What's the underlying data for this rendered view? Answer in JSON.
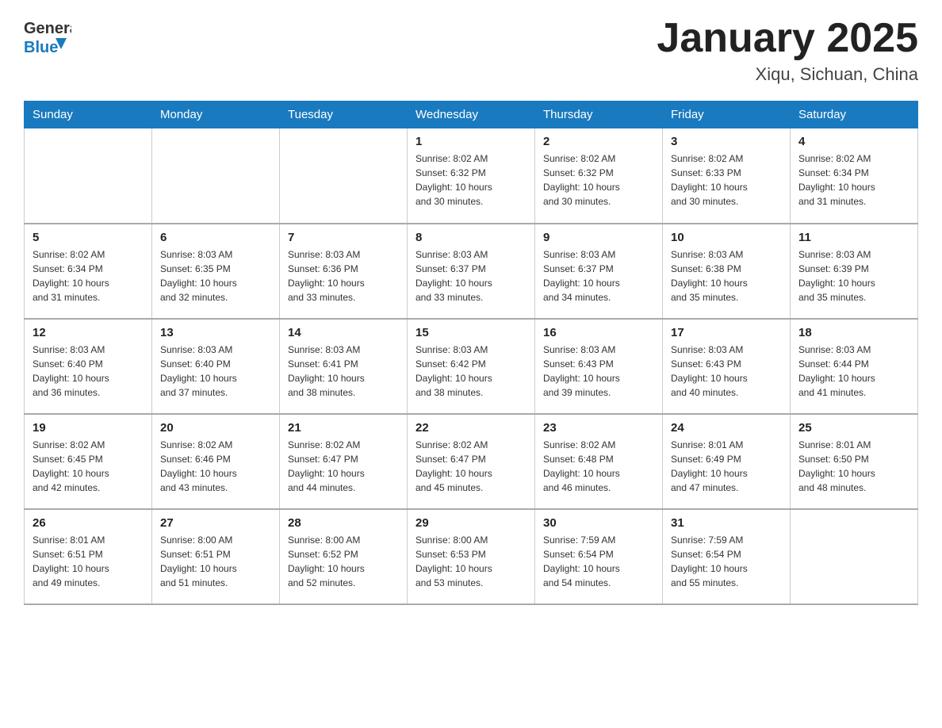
{
  "header": {
    "logo_general": "General",
    "logo_blue": "Blue",
    "month_title": "January 2025",
    "location": "Xiqu, Sichuan, China"
  },
  "days_of_week": [
    "Sunday",
    "Monday",
    "Tuesday",
    "Wednesday",
    "Thursday",
    "Friday",
    "Saturday"
  ],
  "weeks": [
    [
      {
        "day": "",
        "info": ""
      },
      {
        "day": "",
        "info": ""
      },
      {
        "day": "",
        "info": ""
      },
      {
        "day": "1",
        "info": "Sunrise: 8:02 AM\nSunset: 6:32 PM\nDaylight: 10 hours\nand 30 minutes."
      },
      {
        "day": "2",
        "info": "Sunrise: 8:02 AM\nSunset: 6:32 PM\nDaylight: 10 hours\nand 30 minutes."
      },
      {
        "day": "3",
        "info": "Sunrise: 8:02 AM\nSunset: 6:33 PM\nDaylight: 10 hours\nand 30 minutes."
      },
      {
        "day": "4",
        "info": "Sunrise: 8:02 AM\nSunset: 6:34 PM\nDaylight: 10 hours\nand 31 minutes."
      }
    ],
    [
      {
        "day": "5",
        "info": "Sunrise: 8:02 AM\nSunset: 6:34 PM\nDaylight: 10 hours\nand 31 minutes."
      },
      {
        "day": "6",
        "info": "Sunrise: 8:03 AM\nSunset: 6:35 PM\nDaylight: 10 hours\nand 32 minutes."
      },
      {
        "day": "7",
        "info": "Sunrise: 8:03 AM\nSunset: 6:36 PM\nDaylight: 10 hours\nand 33 minutes."
      },
      {
        "day": "8",
        "info": "Sunrise: 8:03 AM\nSunset: 6:37 PM\nDaylight: 10 hours\nand 33 minutes."
      },
      {
        "day": "9",
        "info": "Sunrise: 8:03 AM\nSunset: 6:37 PM\nDaylight: 10 hours\nand 34 minutes."
      },
      {
        "day": "10",
        "info": "Sunrise: 8:03 AM\nSunset: 6:38 PM\nDaylight: 10 hours\nand 35 minutes."
      },
      {
        "day": "11",
        "info": "Sunrise: 8:03 AM\nSunset: 6:39 PM\nDaylight: 10 hours\nand 35 minutes."
      }
    ],
    [
      {
        "day": "12",
        "info": "Sunrise: 8:03 AM\nSunset: 6:40 PM\nDaylight: 10 hours\nand 36 minutes."
      },
      {
        "day": "13",
        "info": "Sunrise: 8:03 AM\nSunset: 6:40 PM\nDaylight: 10 hours\nand 37 minutes."
      },
      {
        "day": "14",
        "info": "Sunrise: 8:03 AM\nSunset: 6:41 PM\nDaylight: 10 hours\nand 38 minutes."
      },
      {
        "day": "15",
        "info": "Sunrise: 8:03 AM\nSunset: 6:42 PM\nDaylight: 10 hours\nand 38 minutes."
      },
      {
        "day": "16",
        "info": "Sunrise: 8:03 AM\nSunset: 6:43 PM\nDaylight: 10 hours\nand 39 minutes."
      },
      {
        "day": "17",
        "info": "Sunrise: 8:03 AM\nSunset: 6:43 PM\nDaylight: 10 hours\nand 40 minutes."
      },
      {
        "day": "18",
        "info": "Sunrise: 8:03 AM\nSunset: 6:44 PM\nDaylight: 10 hours\nand 41 minutes."
      }
    ],
    [
      {
        "day": "19",
        "info": "Sunrise: 8:02 AM\nSunset: 6:45 PM\nDaylight: 10 hours\nand 42 minutes."
      },
      {
        "day": "20",
        "info": "Sunrise: 8:02 AM\nSunset: 6:46 PM\nDaylight: 10 hours\nand 43 minutes."
      },
      {
        "day": "21",
        "info": "Sunrise: 8:02 AM\nSunset: 6:47 PM\nDaylight: 10 hours\nand 44 minutes."
      },
      {
        "day": "22",
        "info": "Sunrise: 8:02 AM\nSunset: 6:47 PM\nDaylight: 10 hours\nand 45 minutes."
      },
      {
        "day": "23",
        "info": "Sunrise: 8:02 AM\nSunset: 6:48 PM\nDaylight: 10 hours\nand 46 minutes."
      },
      {
        "day": "24",
        "info": "Sunrise: 8:01 AM\nSunset: 6:49 PM\nDaylight: 10 hours\nand 47 minutes."
      },
      {
        "day": "25",
        "info": "Sunrise: 8:01 AM\nSunset: 6:50 PM\nDaylight: 10 hours\nand 48 minutes."
      }
    ],
    [
      {
        "day": "26",
        "info": "Sunrise: 8:01 AM\nSunset: 6:51 PM\nDaylight: 10 hours\nand 49 minutes."
      },
      {
        "day": "27",
        "info": "Sunrise: 8:00 AM\nSunset: 6:51 PM\nDaylight: 10 hours\nand 51 minutes."
      },
      {
        "day": "28",
        "info": "Sunrise: 8:00 AM\nSunset: 6:52 PM\nDaylight: 10 hours\nand 52 minutes."
      },
      {
        "day": "29",
        "info": "Sunrise: 8:00 AM\nSunset: 6:53 PM\nDaylight: 10 hours\nand 53 minutes."
      },
      {
        "day": "30",
        "info": "Sunrise: 7:59 AM\nSunset: 6:54 PM\nDaylight: 10 hours\nand 54 minutes."
      },
      {
        "day": "31",
        "info": "Sunrise: 7:59 AM\nSunset: 6:54 PM\nDaylight: 10 hours\nand 55 minutes."
      },
      {
        "day": "",
        "info": ""
      }
    ]
  ]
}
